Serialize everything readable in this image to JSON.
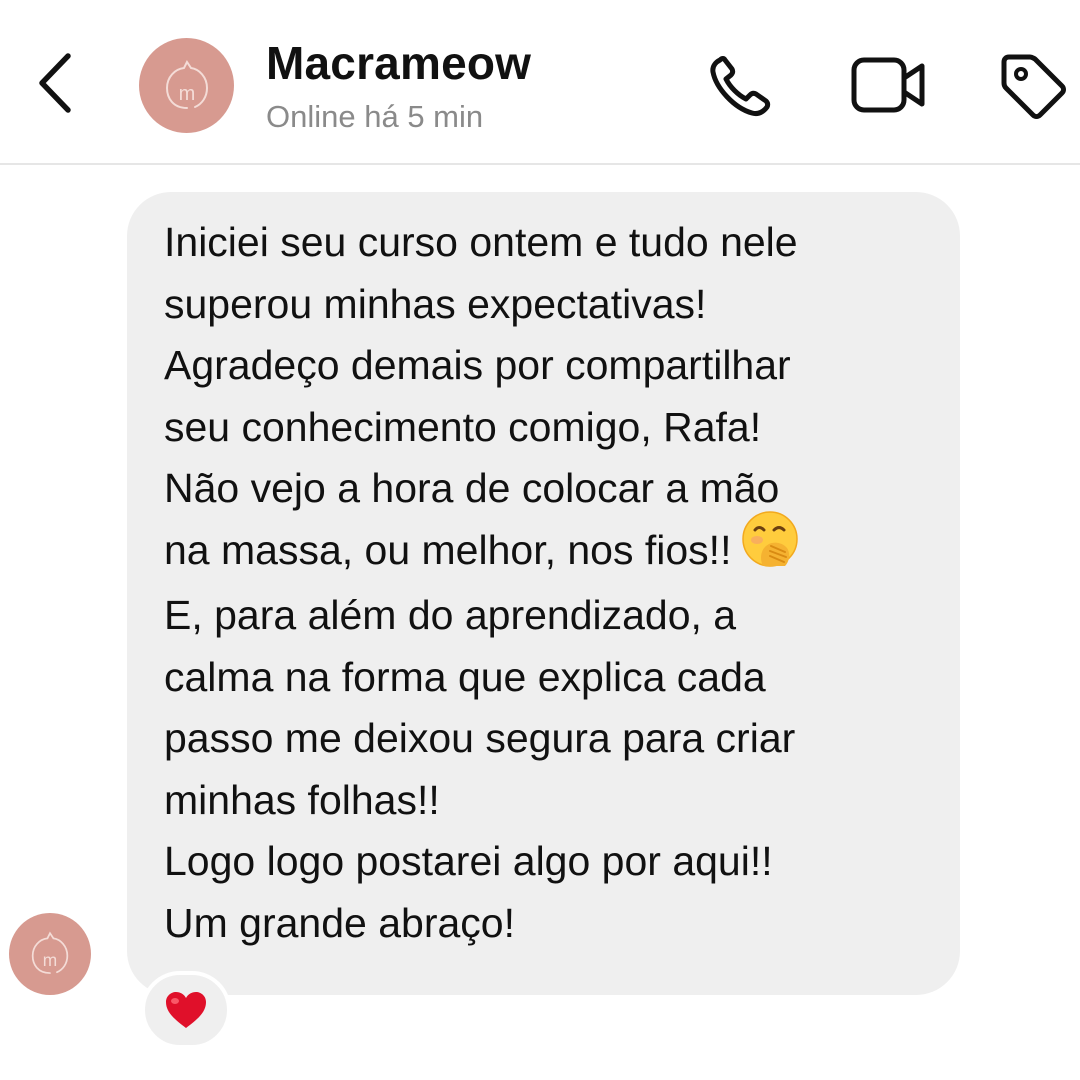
{
  "header": {
    "contact_name": "Macrameow",
    "status": "Online há 5 min",
    "avatar_letter": "m"
  },
  "icons": {
    "back": "chevron-left-icon",
    "phone": "phone-icon",
    "video": "video-camera-icon",
    "tag": "tag-icon",
    "avatar_logo": "cat-logo-icon",
    "emoji": "hand-over-mouth-emoji",
    "reaction": "red-heart-icon"
  },
  "colors": {
    "avatar_bg": "#d79a90",
    "bubble_bg": "#efefef",
    "status_text": "#8a8a8a",
    "heart": "#e0102a"
  },
  "message": {
    "lines": [
      "Iniciei seu curso ontem e tudo nele",
      "superou minhas expectativas!",
      "Agradeço demais por compartilhar",
      "seu conhecimento comigo, Rafa!",
      "Não vejo a hora de colocar a mão",
      "na massa, ou melhor, nos fios!!",
      "E, para além do aprendizado, a",
      "calma na forma que explica cada",
      "passo me deixou segura para criar",
      "minhas folhas!!",
      "Logo logo postarei algo por aqui!!",
      "Um grande abraço!"
    ]
  }
}
